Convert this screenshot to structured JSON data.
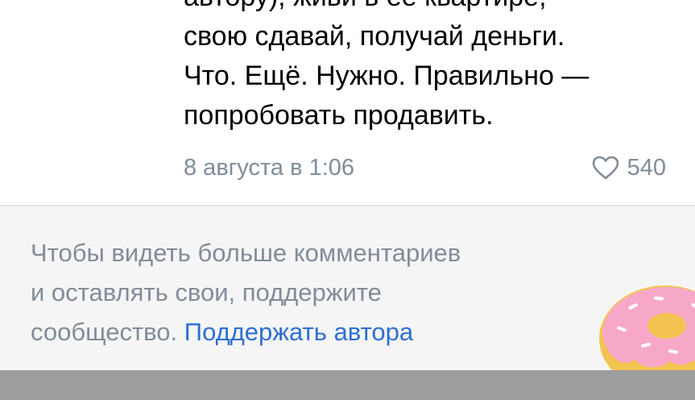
{
  "comment": {
    "lines": [
      "автору), живи в её квартире,",
      "свою сдавай, получай деньги.",
      "Что. Ещё. Нужно. Правильно —",
      "попробовать продавить."
    ],
    "date": "8 августа в 1:06",
    "likes": "540",
    "like_icon": "heart-outline-icon"
  },
  "paywall": {
    "line1": "Чтобы видеть больше комментариев",
    "line2": "и оставлять свои, поддержите",
    "line3_prefix": "сообщество.",
    "link_label": "Поддержать автора",
    "illustration_icon": "donut-icon"
  },
  "colors": {
    "text_primary": "#000000",
    "text_secondary": "#818c99",
    "link": "#2c6fd1",
    "paywall_bg": "#f5f5f6",
    "bottom_bar": "#9d9d9f",
    "donut_glaze": "#f7a8c9",
    "donut_dough": "#f3c451"
  }
}
